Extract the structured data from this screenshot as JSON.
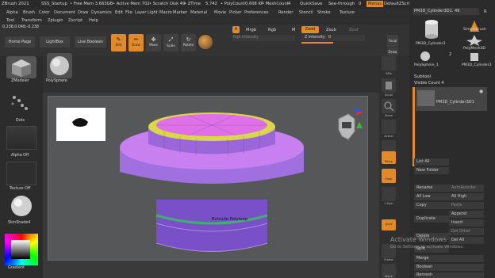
{
  "titlebar": {
    "app": "ZBrush 2021",
    "doc": "SSS_Startup",
    "free_mem": "• Free Mem 3.663GB",
    "active_mem": "• Active Mem 702",
    "scratch": "• Scratch Disk 49",
    "ztime": "• ZTime",
    "ztime_val": "5.742",
    "polycount": "• PolyCount",
    "polycount_val": "0.608 KP",
    "meshcount": "• MeshCount",
    "meshcount_val": "4",
    "quicksave": "QuickSave",
    "see_through": "See-through",
    "see_through_val": "0",
    "menus": "Menus",
    "default_zscript": "DefaultZScript"
  },
  "menus": {
    "row1": [
      "Alpha",
      "Brush",
      "Color",
      "Document",
      "Draw",
      "Dynamics",
      "Edit",
      "File",
      "Layer",
      "Light",
      "Macro",
      "Marker",
      "Material",
      "Movie",
      "Picker",
      "Preferences",
      "Render",
      "Stencil",
      "Stroke",
      "Texture"
    ],
    "row2": [
      "Tool",
      "Transform",
      "Zplugin",
      "Zscript",
      "Help"
    ]
  },
  "toolbar": {
    "coords": "0.238,0.048,-0.238",
    "home": "Home Page",
    "lightbox": "LightBox",
    "live_boolean": "Live Boolean",
    "edit": "Edit",
    "draw": "Draw",
    "move": "Move",
    "scale": "Scale",
    "rotate": "Rotate",
    "a": "A",
    "mrgb": "Mrgb",
    "rgb": "Rgb",
    "m": "M",
    "zadd": "Zadd",
    "zsub": "Zsub",
    "zcut": "Zcut",
    "rgb_intensity": "Rgb Intensity",
    "z_intensity": "Z Intensity",
    "z_intensity_val": "0",
    "focal": "Focal",
    "draw2": "Draw"
  },
  "leftpanel": {
    "zmodeler": "ZModeler",
    "polysphere": "PolySphere",
    "dots": "Dots",
    "alpha_off": "Alpha Off",
    "texture_off": "Texture Off",
    "skinshade": "SkinShade4",
    "gradient": "Gradient"
  },
  "rshelf": [
    "SPix",
    "Scroll",
    "Zoom",
    "Actual",
    "AAHalf",
    "Persp",
    "Floor",
    "L.Sym",
    "Qxyz",
    "Frame",
    "Move"
  ],
  "rshelf_extra": {
    "spix_val": "3"
  },
  "canvas": {
    "tooltip": "Extrude Polyloop"
  },
  "rpanel": {
    "top_tool": "PM3D_Cylinder3D1. 49",
    "r_label": "R",
    "thumbs": [
      "PM3D_Cylinder3",
      "SimpleBrush",
      "PolySphere_1",
      "PolyMesh3D",
      "PM3D_Cylinder3"
    ],
    "thumb_badge": "2",
    "subtool": "Subtool",
    "visible_count": "Visible Count 4",
    "subtool_item": "PM3D_Cylinder3D1",
    "list_all": "List All",
    "new_folder": "New Folder",
    "rename": "Rename",
    "autoreorder": "AutoReorder",
    "all_low": "All Low",
    "all_high": "All High",
    "copy": "Copy",
    "paste": "Paste",
    "append": "Append",
    "duplicate": "Duplicate",
    "insert": "Insert",
    "delete": "Delete",
    "del_other": "Del Other",
    "del_all": "Del All",
    "split": "Split",
    "merge": "Merge",
    "boolean": "Boolean",
    "remesh": "Remesh"
  },
  "watermark": {
    "line1": "Activate Windows",
    "line2": "Go to Settings to activate Windows."
  },
  "colors": {
    "accent": "#e08a2a",
    "top_disc": "#c86ad8",
    "ring": "#d8d84a",
    "body": "#9a6ad8"
  }
}
